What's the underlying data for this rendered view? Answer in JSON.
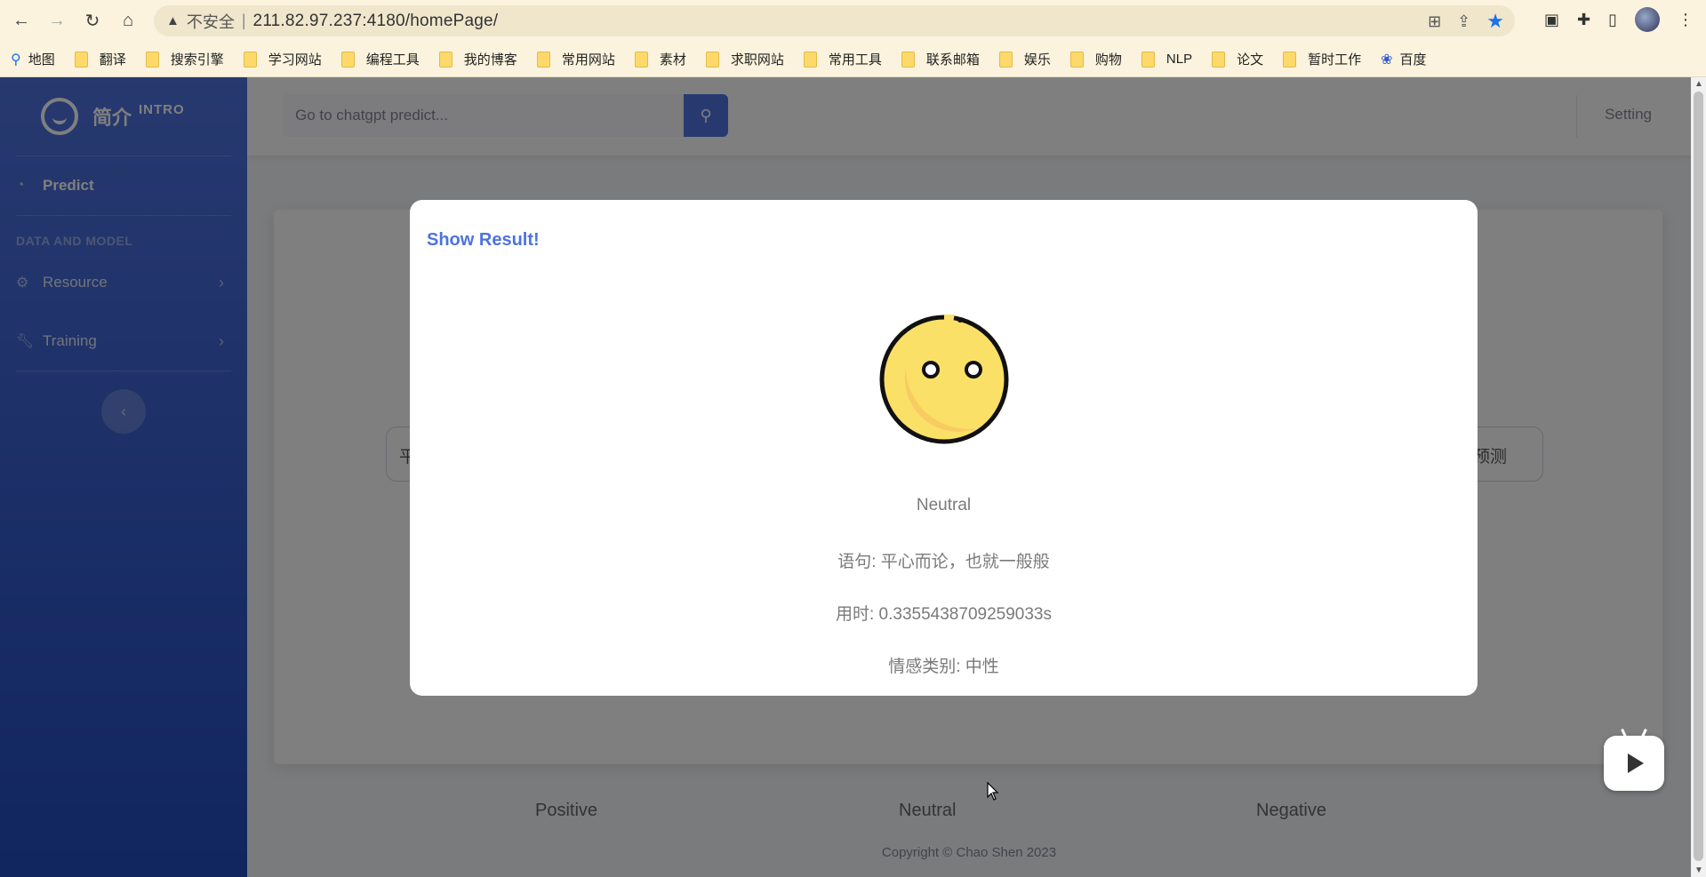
{
  "browser": {
    "security_label": "不安全",
    "url": "211.82.97.237:4180/homePage/"
  },
  "bookmarks": [
    "地图",
    "翻译",
    "搜索引擎",
    "学习网站",
    "编程工具",
    "我的博客",
    "常用网站",
    "素材",
    "求职网站",
    "常用工具",
    "联系邮箱",
    "娱乐",
    "购物",
    "NLP",
    "论文",
    "暂时工作",
    "百度"
  ],
  "sidebar": {
    "brand_name": "简介",
    "brand_sup": "INTRO",
    "items": [
      {
        "label": "Predict"
      },
      {
        "label": "Resource"
      },
      {
        "label": "Training"
      }
    ],
    "heading": "DATA AND MODEL"
  },
  "topbar": {
    "search_placeholder": "Go to chatgpt predict...",
    "setting_label": "Setting"
  },
  "main": {
    "input_value": "平",
    "predict_button": "预测",
    "emotions": [
      "Positive",
      "Neutral",
      "Negative"
    ]
  },
  "footer": {
    "copyright": "Copyright © Chao Shen 2023"
  },
  "modal": {
    "title": "Show Result!",
    "emotion": "Neutral",
    "sentence": "语句: 平心而论，也就一般般",
    "time": "用时: 0.3355438709259033s",
    "category": "情感类别: 中性"
  }
}
